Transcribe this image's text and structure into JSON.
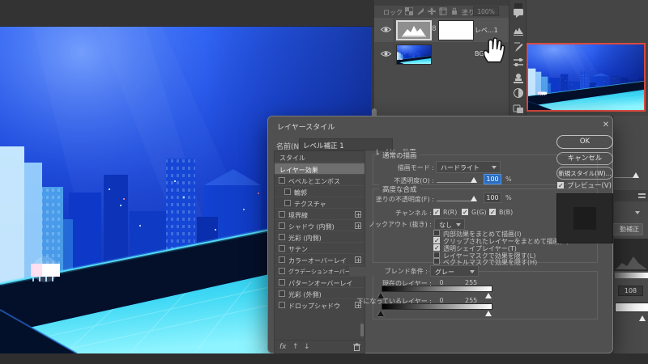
{
  "dialog": {
    "title": "レイヤースタイル",
    "close_icon": "✕",
    "name_label": "名前(N) :",
    "name_value": "レベル補正 1",
    "styles": {
      "header": "スタイル",
      "items": [
        {
          "label": "レイヤー効果",
          "selected": true
        },
        {
          "label": "ベベルとエンボス",
          "checked": false
        },
        {
          "label": "輪郭",
          "checked": false
        },
        {
          "label": "テクスチャ",
          "checked": false
        },
        {
          "label": "境界線",
          "checked": false,
          "plus": true
        },
        {
          "label": "シャドウ (内側)",
          "checked": false,
          "plus": true
        },
        {
          "label": "光彩 (内側)",
          "checked": false
        },
        {
          "label": "サテン",
          "checked": false
        },
        {
          "label": "カラーオーバーレイ",
          "checked": false,
          "plus": true
        },
        {
          "label": "グラデーションオーバーレイ",
          "checked": false,
          "plus": true
        },
        {
          "label": "パターンオーバーレイ",
          "checked": false
        },
        {
          "label": "光彩 (外側)",
          "checked": false
        },
        {
          "label": "ドロップシャドウ",
          "checked": false,
          "plus": true
        }
      ],
      "footer": {
        "fx": "fx",
        "up": "↑",
        "down": "↓"
      }
    },
    "effects": {
      "section_title": "レイヤー効果",
      "blend_group": {
        "title": "通常の描画",
        "blend_mode_label": "描画モード :",
        "blend_mode_value": "ハードライト",
        "opacity_label": "不透明度(O) :",
        "opacity_value": "100",
        "percent": "%"
      },
      "advanced_group": {
        "title": "高度な合成",
        "fill_opacity_label": "塗りの不透明度(F) :",
        "fill_opacity_value": "100",
        "percent": "%",
        "channels_label": "チャンネル :",
        "channels": [
          {
            "label": "R(R)",
            "checked": true
          },
          {
            "label": "G(G)",
            "checked": true
          },
          {
            "label": "B(B)",
            "checked": true
          }
        ],
        "knockout_label": "ノックアウト (抜き) :",
        "knockout_value": "なし",
        "options": [
          {
            "label": "内部効果をまとめて描画(I)",
            "checked": false
          },
          {
            "label": "クリップされたレイヤーをまとめて描画(C)",
            "checked": true
          },
          {
            "label": "透明シェイプレイヤー(T)",
            "checked": true
          },
          {
            "label": "レイヤーマスクで効果を隠す(L)",
            "checked": false
          },
          {
            "label": "ベクトルマスクで効果を隠す(H)",
            "checked": false
          }
        ]
      },
      "blend_if_group": {
        "label": "ブレンド条件 :",
        "value": "グレー",
        "current_layer_label": "現在のレイヤー :",
        "current_min": "0",
        "current_max": "255",
        "underlying_label": "下になっているレイヤー :",
        "underlying_min": "0",
        "underlying_max": "255"
      }
    },
    "buttons": {
      "ok": "OK",
      "cancel": "キャンセル",
      "new_style": "新規スタイル(W)...",
      "preview_label": "プレビュー(V)",
      "preview_checked": true
    }
  },
  "layers_panel": {
    "lock_label": "ロック :",
    "fill_label": "塗り :",
    "fill_value": "100%",
    "layers": [
      {
        "name": "レベ...1",
        "type": "levels-adjustment",
        "selected": true,
        "visible": true
      },
      {
        "name": "BG",
        "type": "image",
        "visible": true
      }
    ]
  },
  "properties_panel": {
    "auto_button": "動補正",
    "value": "108"
  },
  "colors": {
    "accent_selection": "#2a6cc0",
    "navigator_proxy_red": "#d94a3e",
    "dialog_bg": "#505050",
    "canvas_blue": "#1443d8",
    "pool_cyan": "#3fdcf5"
  }
}
